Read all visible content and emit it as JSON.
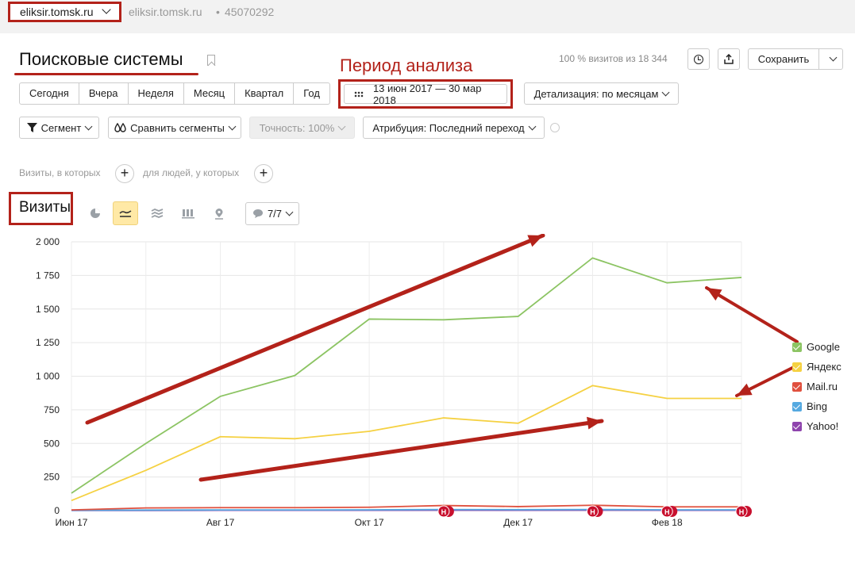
{
  "header": {
    "site_select": "eliksir.tomsk.ru",
    "breadcrumb_site": "eliksir.tomsk.ru",
    "breadcrumb_sep": "•",
    "counter_id": "45070292"
  },
  "report": {
    "title": "Поисковые системы",
    "annotation_period": "Период анализа",
    "visits_total": "100 % визитов из 18 344",
    "save_label": "Сохранить"
  },
  "periods": [
    "Сегодня",
    "Вчера",
    "Неделя",
    "Месяц",
    "Квартал",
    "Год"
  ],
  "date_range": "13 июн 2017 — 30 мар 2018",
  "detail_label": "Детализация: по месяцам",
  "filters": {
    "segment": "Сегмент",
    "compare": "Сравнить сегменты",
    "accuracy": "Точность: 100%",
    "attribution": "Атрибуция: Последний переход",
    "visits_where": "Визиты, в которых",
    "people_where": "для людей, у которых"
  },
  "chart_header": {
    "title": "Визиты",
    "series_toggle": "7/7"
  },
  "colors": {
    "accent_red": "#b3221a",
    "google": "#8cc463",
    "yandex": "#f5d142",
    "mailru": "#e0503e",
    "bing": "#55a9e0",
    "yahoo": "#8e44ad"
  },
  "chart_data": {
    "type": "line",
    "title": "",
    "xlabel": "",
    "ylabel": "",
    "ylim": [
      0,
      2000
    ],
    "yticks": [
      0,
      250,
      500,
      750,
      1000,
      1250,
      1500,
      1750,
      2000
    ],
    "ytick_labels": [
      "0",
      "250",
      "500",
      "750",
      "1 000",
      "1 250",
      "1 500",
      "1 750",
      "2 000"
    ],
    "x": [
      "2017-06",
      "2017-07",
      "2017-08",
      "2017-09",
      "2017-10",
      "2017-11",
      "2017-12",
      "2018-01",
      "2018-02",
      "2018-03"
    ],
    "x_tick_labels": [
      {
        "at": "2017-06",
        "label": "Июн 17"
      },
      {
        "at": "2017-08",
        "label": "Авг 17"
      },
      {
        "at": "2017-10",
        "label": "Окт 17"
      },
      {
        "at": "2017-12",
        "label": "Дек 17"
      },
      {
        "at": "2018-02",
        "label": "Фев 18"
      }
    ],
    "grid": true,
    "legend_position": "right",
    "series": [
      {
        "name": "Google",
        "color": "#8cc463",
        "values": [
          130,
          500,
          850,
          1005,
          1425,
          1420,
          1445,
          1880,
          1695,
          1735
        ]
      },
      {
        "name": "Яндекс",
        "color": "#f5d142",
        "values": [
          75,
          300,
          550,
          535,
          590,
          690,
          650,
          930,
          835,
          835
        ]
      },
      {
        "name": "Mail.ru",
        "color": "#e0503e",
        "values": [
          5,
          20,
          22,
          22,
          25,
          38,
          30,
          40,
          28,
          28
        ]
      },
      {
        "name": "Bing",
        "color": "#55a9e0",
        "values": [
          2,
          4,
          5,
          5,
          6,
          8,
          7,
          8,
          6,
          6
        ]
      },
      {
        "name": "Yahoo!",
        "color": "#8e44ad",
        "values": [
          1,
          1,
          2,
          2,
          2,
          3,
          2,
          3,
          2,
          2
        ]
      }
    ],
    "markers": {
      "label": "Н",
      "at": [
        "2017-11",
        "2018-01",
        "2018-02",
        "2018-03"
      ]
    }
  }
}
